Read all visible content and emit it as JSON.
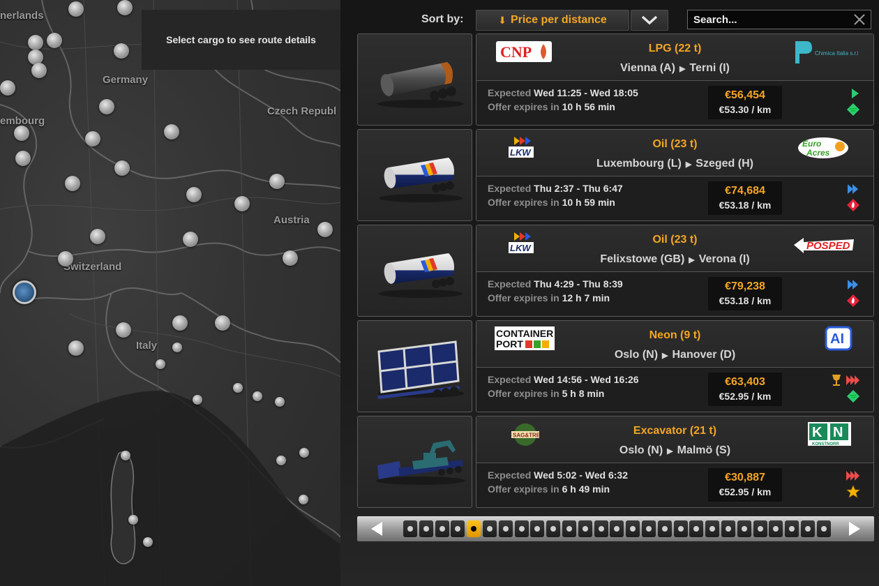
{
  "map": {
    "route_hint": "Select cargo to see route details",
    "labels": [
      "nerlands",
      "Germany",
      "Czech Republ",
      "embourg",
      "Austria",
      "Switzerland",
      "Italy"
    ]
  },
  "toolbar": {
    "sort_label": "Sort by:",
    "sort_value": "Price per distance",
    "search_placeholder": "Search..."
  },
  "jobs": [
    {
      "cargo": "LPG (22 t)",
      "from": "Vienna (A)",
      "to": "Terni (I)",
      "source_company": "CNP",
      "target_company": "Chimica Italia s.r.l.",
      "expected_label": "Expected",
      "expected_time": "Wed 11:25 - Wed 18:05",
      "expires_label": "Offer expires in",
      "expires_time": "10 h 56 min",
      "price": "€56,454",
      "price_per_km": "€53.30 / km",
      "icons": [
        "urgency-normal-icon",
        "hazardous-gas-icon"
      ]
    },
    {
      "cargo": "Oil (23 t)",
      "from": "Luxembourg (L)",
      "to": "Szeged (H)",
      "source_company": "LKW",
      "target_company": "Euro Acres",
      "expected_label": "Expected",
      "expected_time": "Thu 2:37 - Thu 6:47",
      "expires_label": "Offer expires in",
      "expires_time": "10 h 59 min",
      "price": "€74,684",
      "price_per_km": "€53.18 / km",
      "icons": [
        "urgency-important-icon",
        "hazardous-flammable-icon"
      ]
    },
    {
      "cargo": "Oil (23 t)",
      "from": "Felixstowe (GB)",
      "to": "Verona (I)",
      "source_company": "LKW",
      "target_company": "POSPED",
      "expected_label": "Expected",
      "expected_time": "Thu 4:29 - Thu 8:39",
      "expires_label": "Offer expires in",
      "expires_time": "12 h 7 min",
      "price": "€79,238",
      "price_per_km": "€53.18 / km",
      "icons": [
        "urgency-important-icon",
        "hazardous-flammable-icon"
      ]
    },
    {
      "cargo": "Neon (9 t)",
      "from": "Oslo (N)",
      "to": "Hanover (D)",
      "source_company": "CONTAINER PORT",
      "target_company": "AI",
      "expected_label": "Expected",
      "expected_time": "Wed 14:56 - Wed 16:26",
      "expires_label": "Offer expires in",
      "expires_time": "5 h 8 min",
      "price": "€63,403",
      "price_per_km": "€52.95 / km",
      "icons": [
        "fragile-cargo-icon",
        "urgency-urgent-icon",
        "hazardous-gas-icon"
      ]
    },
    {
      "cargo": "Excavator (21 t)",
      "from": "Oslo (N)",
      "to": "Malmö (S)",
      "source_company": "SAG&TRE",
      "target_company": "KONSTNORR",
      "expected_label": "Expected",
      "expected_time": "Wed 5:02 - Wed 6:32",
      "expires_label": "Offer expires in",
      "expires_time": "6 h 49 min",
      "price": "€30,887",
      "price_per_km": "€52.95 / km",
      "icons": [
        "urgency-urgent-icon",
        "special-transport-star-icon"
      ]
    }
  ],
  "pager": {
    "page_count": 27,
    "current_page": 5
  },
  "colors": {
    "accent": "#f5a623",
    "hazard_green": "#2ecc71",
    "hazard_red": "#e8213a",
    "urgency_blue": "#3a8fe8",
    "urgency_red": "#f04b4b"
  }
}
